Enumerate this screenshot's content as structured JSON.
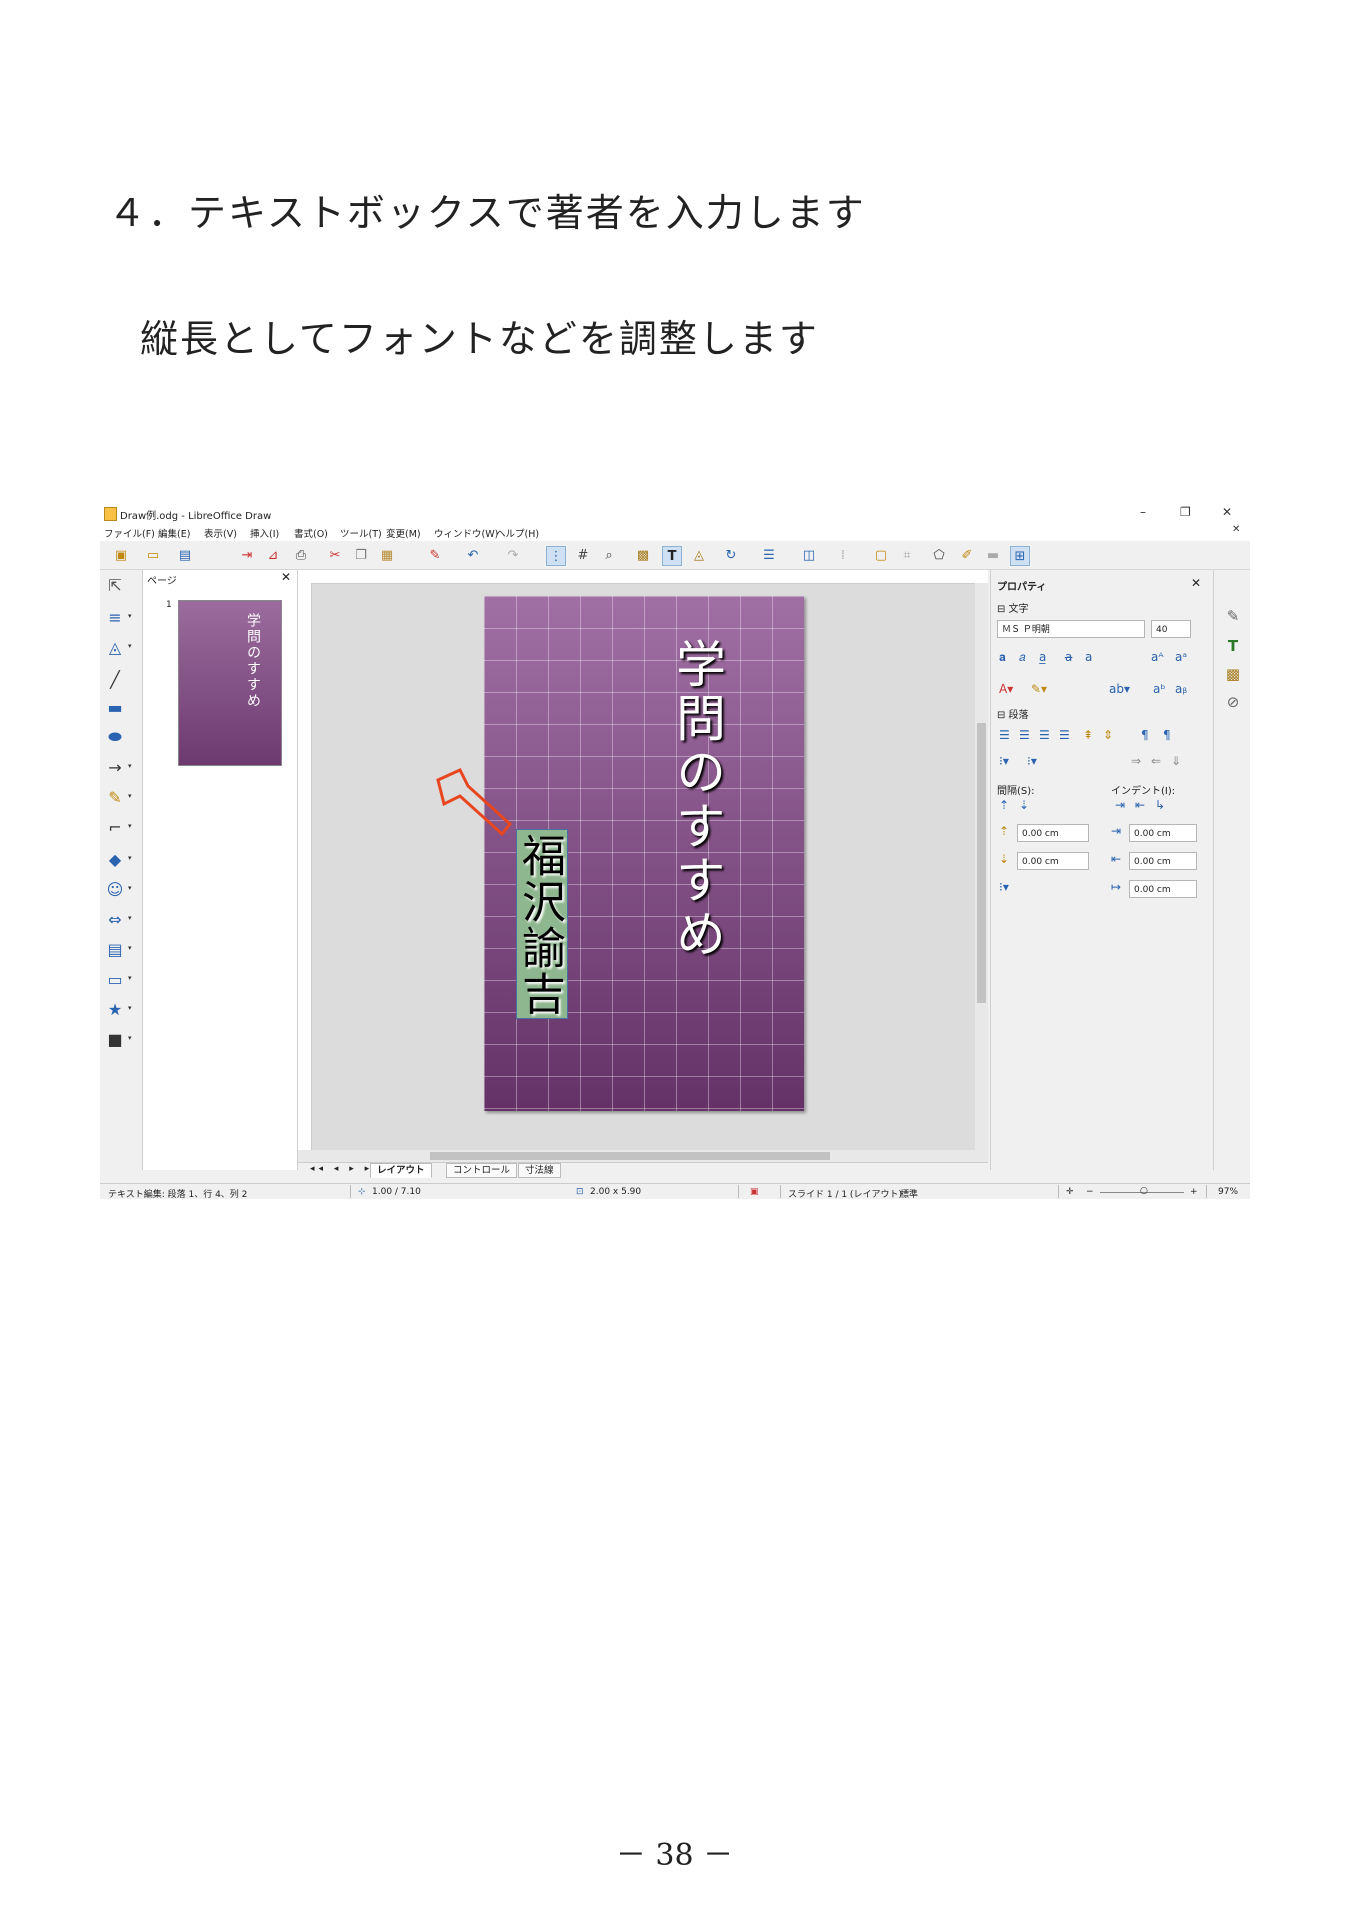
{
  "doc": {
    "heading1": "４．テキストボックスで著者を入力します",
    "heading2": "縦長としてフォントなどを調整します",
    "page_number": "－ 38 －"
  },
  "window": {
    "title": "Draw例.odg - LibreOffice Draw",
    "controls": {
      "minimize": "–",
      "restore": "❐",
      "close": "✕",
      "doc_close": "✕"
    }
  },
  "menu": [
    "ファイル(F)",
    "編集(E)",
    "表示(V)",
    "挿入(I)",
    "書式(O)",
    "ツール(T)",
    "変更(M)",
    "ウィンドウ(W)",
    "ヘルプ(H)"
  ],
  "pages_panel": {
    "header": "ページ",
    "close": "✕",
    "thumb_number": "1",
    "thumb_text": "学問のすすめ"
  },
  "slide": {
    "title": "学問のすすめ",
    "author": "福沢諭吉"
  },
  "tabs": {
    "nav": "◂◂ ◂ ▸ ▸▸",
    "items": [
      "レイアウト",
      "コントロール",
      "寸法線"
    ]
  },
  "properties": {
    "header": "プロパティ",
    "close": "✕",
    "character_section": "⊟ 文字",
    "font_name": "ＭＳ Ｐ明朝",
    "font_size": "40",
    "paragraph_section": "⊟ 段落",
    "spacing_label": "間隔(S):",
    "indent_label": "インデント(I):",
    "spacing_above": "0.00 cm",
    "spacing_below": "0.00 cm",
    "indent_before": "0.00 cm",
    "indent_after": "0.00 cm",
    "indent_first": "0.00 cm"
  },
  "status": {
    "mode": "テキスト編集: 段落 1、行 4、列 2",
    "position": "1.00 / 7.10",
    "size": "2.00 x 5.90",
    "slide": "スライド 1 / 1 (レイアウト)",
    "style": "標準",
    "zoom": "97%"
  },
  "colors": {
    "slide_top": "#a06fa3",
    "slide_bottom": "#643266",
    "author_box": "#8fb78f",
    "arrow": "#e8461f"
  }
}
